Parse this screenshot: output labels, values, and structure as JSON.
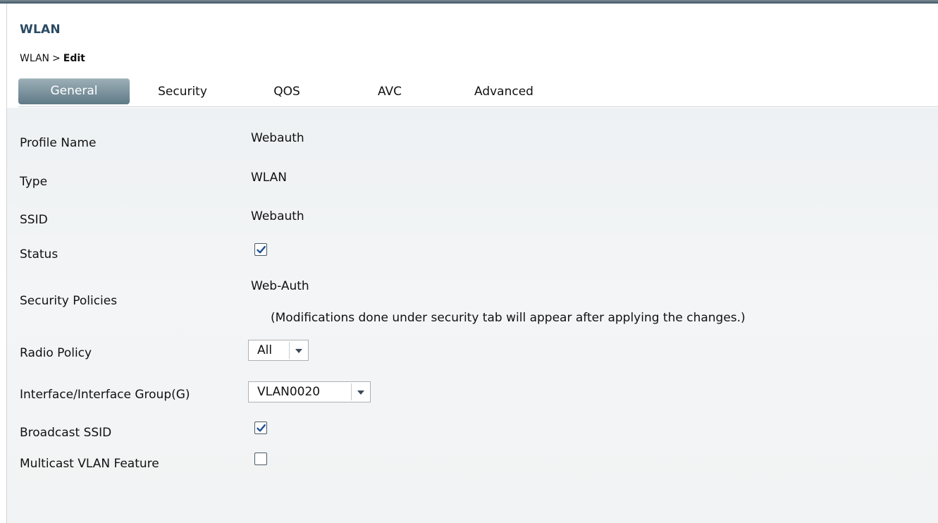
{
  "header": {
    "title": "WLAN",
    "breadcrumb": {
      "parent": "WLAN",
      "separator": ">",
      "current": "Edit"
    }
  },
  "tabs": [
    {
      "label": "General",
      "active": true
    },
    {
      "label": "Security",
      "active": false
    },
    {
      "label": "QOS",
      "active": false
    },
    {
      "label": "AVC",
      "active": false
    },
    {
      "label": "Advanced",
      "active": false
    }
  ],
  "form": {
    "profile_name": {
      "label": "Profile Name",
      "value": "Webauth"
    },
    "type": {
      "label": "Type",
      "value": "WLAN"
    },
    "ssid": {
      "label": "SSID",
      "value": "Webauth"
    },
    "status": {
      "label": "Status",
      "checked": true
    },
    "security_policies": {
      "label": "Security Policies",
      "value": "Web-Auth",
      "note": "(Modifications done under security tab will appear after applying the changes.)"
    },
    "radio_policy": {
      "label": "Radio Policy",
      "selected": "All"
    },
    "interface_group": {
      "label": "Interface/Interface Group(G)",
      "selected": "VLAN0020"
    },
    "broadcast_ssid": {
      "label": "Broadcast SSID",
      "checked": true
    },
    "multicast_vlan": {
      "label": "Multicast VLAN Feature",
      "checked": false
    }
  },
  "icons": {
    "checkmark": "checkmark-icon",
    "dropdown": "chevron-down-icon"
  },
  "colors": {
    "title": "#2b4a63",
    "active_tab": "#6f8893",
    "panel_bg": "#f1f3f4",
    "check": "#1f4f9a"
  }
}
